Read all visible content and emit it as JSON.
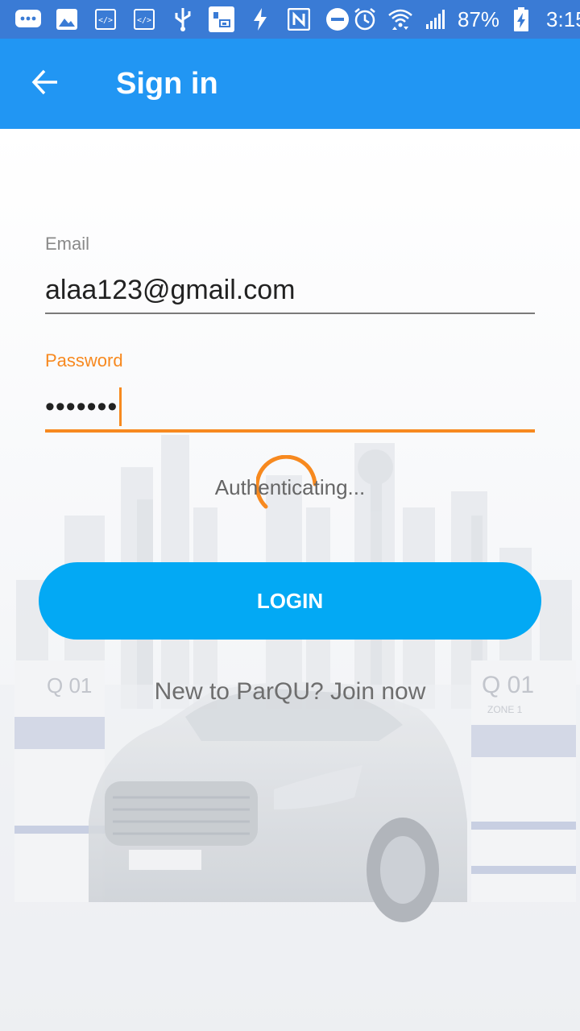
{
  "status_bar": {
    "icons": [
      "messaging-icon",
      "gallery-icon",
      "code-icon",
      "code-icon",
      "usb-icon",
      "screenshot-icon",
      "flash-icon",
      "nfc-icon",
      "do-not-disturb-icon",
      "alarm-icon",
      "wifi-icon",
      "signal-icon"
    ],
    "battery": "87%",
    "time": "3:15"
  },
  "app_bar": {
    "title": "Sign in",
    "back_icon": "arrow-back-icon",
    "color": "#2196f3"
  },
  "form": {
    "email_label": "Email",
    "email_value": "alaa123@gmail.com",
    "password_label": "Password",
    "password_value": "•••••••"
  },
  "loading": {
    "text": "Authenticating..."
  },
  "login_button": {
    "label": "LOGIN",
    "color": "#03a9f4"
  },
  "join": {
    "text": "New to ParQU? Join now"
  },
  "accent_color": "#f7891f",
  "background_plates": [
    "Q 01",
    "ZONE 1"
  ]
}
